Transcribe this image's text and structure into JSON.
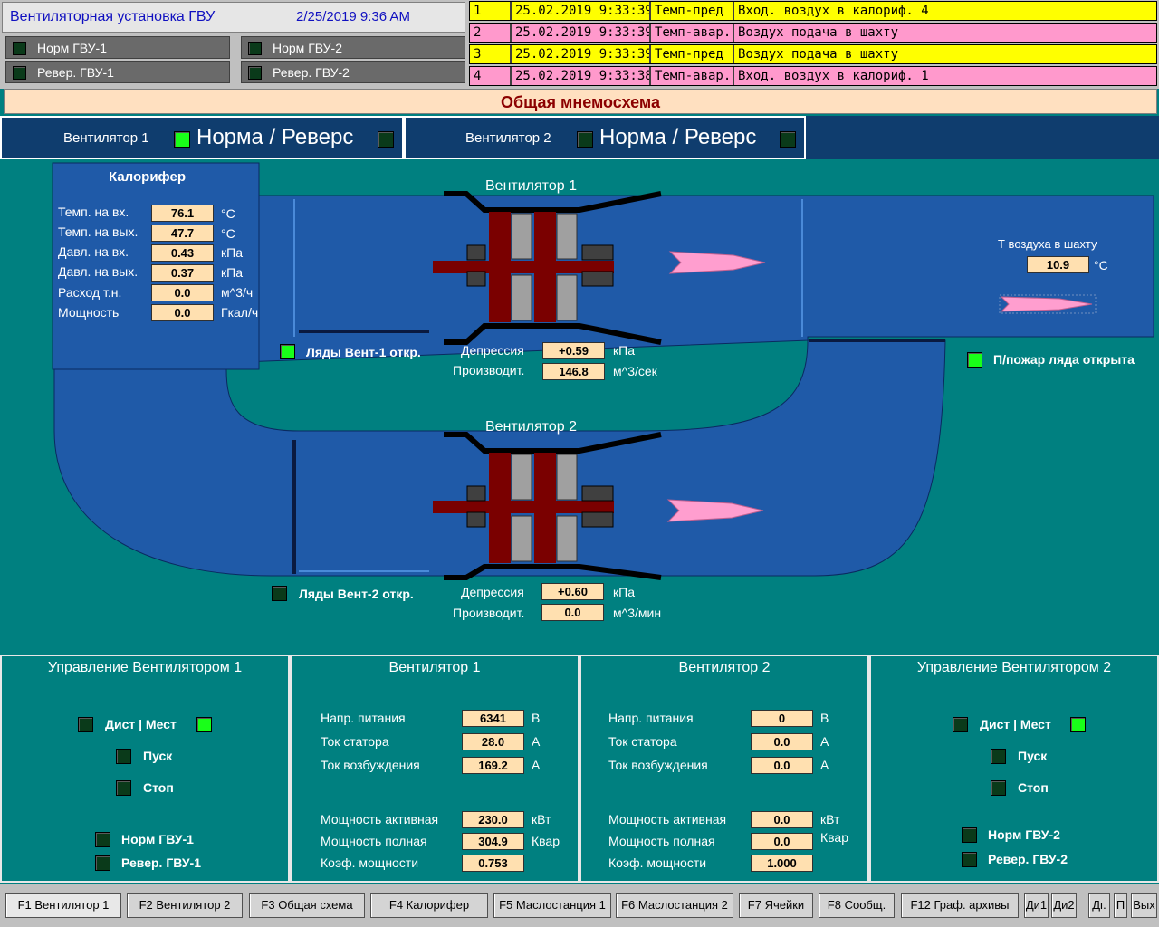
{
  "header": {
    "title": "Вентиляторная установка ГВУ",
    "datetime": "2/25/2019 9:36 AM"
  },
  "status": {
    "norm1": "Норм ГВУ-1",
    "norm2": "Норм ГВУ-2",
    "rev1": "Ревер. ГВУ-1",
    "rev2": "Ревер. ГВУ-2"
  },
  "alarms": [
    {
      "n": "1",
      "time": "25.02.2019 9:33:39",
      "type": "Темп-пред",
      "msg": "Вход. воздух в калориф. 4"
    },
    {
      "n": "2",
      "time": "25.02.2019 9:33:39",
      "type": "Темп-авар.",
      "msg": "Воздух подача в шахту"
    },
    {
      "n": "3",
      "time": "25.02.2019 9:33:39",
      "type": "Темп-пред",
      "msg": "Воздух подача в шахту"
    },
    {
      "n": "4",
      "time": "25.02.2019 9:33:38",
      "type": "Темп-авар.",
      "msg": "Вход. воздух в калориф. 1"
    }
  ],
  "scheme_title": "Общая мнемосхема",
  "fan_headers": {
    "f1": "Вентилятор 1",
    "f2": "Вентилятор 2",
    "mode": "Норма / Реверс"
  },
  "calorifer": {
    "title": "Калорифер",
    "rows": [
      {
        "label": "Темп. на вх.",
        "value": "76.1",
        "unit": "°C"
      },
      {
        "label": "Темп. на вых.",
        "value": "47.7",
        "unit": "°C"
      },
      {
        "label": "Давл. на вх.",
        "value": "0.43",
        "unit": "кПа"
      },
      {
        "label": "Давл. на вых.",
        "value": "0.37",
        "unit": "кПа"
      },
      {
        "label": "Расход т.н.",
        "value": "0.0",
        "unit": "м^3/ч"
      },
      {
        "label": "Мощность",
        "value": "0.0",
        "unit": "Гкал/ч"
      }
    ]
  },
  "fan1": {
    "title": "Вентилятор 1",
    "damper": "Ляды Вент-1 откр.",
    "dep_label": "Депрессия",
    "dep": "+0.59",
    "dep_unit": "кПа",
    "prod_label": "Производит.",
    "prod": "146.8",
    "prod_unit": "м^3/сек"
  },
  "fan2": {
    "title": "Вентилятор 2",
    "damper": "Ляды Вент-2 откр.",
    "dep_label": "Депрессия",
    "dep": "+0.60",
    "dep_unit": "кПа",
    "prod_label": "Производит.",
    "prod": "0.0",
    "prod_unit": "м^3/мин"
  },
  "shaft": {
    "label": "Т воздуха в шахту",
    "value": "10.9",
    "unit": "°C",
    "fire": "П/пожар ляда открыта"
  },
  "ctrl1": {
    "title": "Управление Вентилятором 1",
    "dist": "Дист | Мест",
    "start": "Пуск",
    "stop": "Стоп",
    "norm": "Норм ГВУ-1",
    "rev": "Ревер. ГВУ-1"
  },
  "ctrl2": {
    "title": "Управление Вентилятором 2",
    "dist": "Дист | Мест",
    "start": "Пуск",
    "stop": "Стоп",
    "norm": "Норм ГВУ-2",
    "rev": "Ревер. ГВУ-2"
  },
  "elec1": {
    "title": "Вентилятор 1",
    "rows": [
      {
        "label": "Напр. питания",
        "value": "6341",
        "unit": "В"
      },
      {
        "label": "Ток статора",
        "value": "28.0",
        "unit": "А"
      },
      {
        "label": "Ток возбуждения",
        "value": "169.2",
        "unit": "А"
      },
      {
        "label": "Мощность активная",
        "value": "230.0",
        "unit": "кВт"
      },
      {
        "label": "Мощность полная",
        "value": "304.9",
        "unit": "Квар"
      },
      {
        "label": "Коэф. мощности",
        "value": "0.753",
        "unit": ""
      }
    ]
  },
  "elec2": {
    "title": "Вентилятор 2",
    "rows": [
      {
        "label": "Напр. питания",
        "value": "0",
        "unit": "В"
      },
      {
        "label": "Ток статора",
        "value": "0.0",
        "unit": "А"
      },
      {
        "label": "Ток возбуждения",
        "value": "0.0",
        "unit": "А"
      },
      {
        "label": "Мощность активная",
        "value": "0.0",
        "unit": "кВт"
      },
      {
        "label": "Мощность полная",
        "value": "0.0",
        "unit": "Квар"
      },
      {
        "label": "Коэф. мощности",
        "value": "1.000",
        "unit": ""
      }
    ]
  },
  "fkeys": [
    "F1 Вентилятор 1",
    "F2 Вентилятор 2",
    "F3 Общая схема",
    "F4 Калорифер",
    "F5 Маслостанция 1",
    "F6 Маслостанция 2",
    "F7 Ячейки",
    "F8 Сообщ.",
    "F12 Граф. архивы",
    "Ди1",
    "Ди2",
    "Дг.",
    "П",
    "Вых"
  ],
  "colors": {
    "bg": "#008080",
    "duct": "#1f5aa8",
    "rotor": "#7a0000",
    "arrow": "#ff9ecf",
    "led_on": "#19ff19",
    "warn": "#ffff00",
    "alarm": "#ff99cc"
  }
}
